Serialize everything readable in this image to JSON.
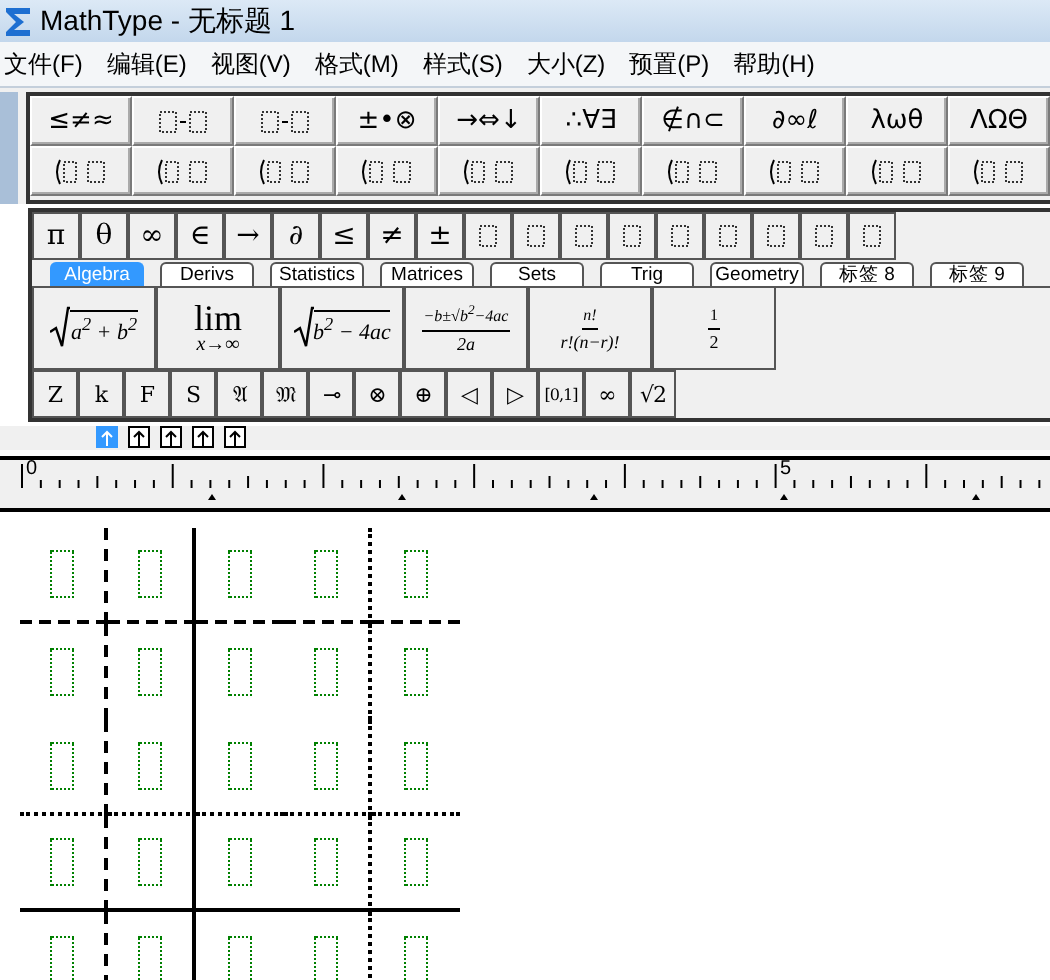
{
  "window": {
    "title": "MathType - 无标题 1"
  },
  "menu": [
    "文件(F)",
    "编辑(E)",
    "视图(V)",
    "格式(M)",
    "样式(S)",
    "大小(Z)",
    "预置(P)",
    "帮助(H)"
  ],
  "symbol_palettes": [
    {
      "kind": "text",
      "label": "≤≠≈"
    },
    {
      "kind": "template"
    },
    {
      "kind": "template"
    },
    {
      "kind": "text",
      "label": "±•⊗"
    },
    {
      "kind": "text",
      "label": "→⇔↓"
    },
    {
      "kind": "text",
      "label": "∴∀∃"
    },
    {
      "kind": "text",
      "label": "∉∩⊂"
    },
    {
      "kind": "text",
      "label": "∂∞ℓ"
    },
    {
      "kind": "text",
      "label": "λωθ"
    },
    {
      "kind": "text",
      "label": "ΛΩΘ"
    }
  ],
  "template_palettes": [
    {
      "kind": "template"
    },
    {
      "kind": "template"
    },
    {
      "kind": "template"
    },
    {
      "kind": "template"
    },
    {
      "kind": "template"
    },
    {
      "kind": "template"
    },
    {
      "kind": "template"
    },
    {
      "kind": "template"
    },
    {
      "kind": "template"
    },
    {
      "kind": "template"
    }
  ],
  "small_bar": [
    {
      "kind": "text",
      "label": "π"
    },
    {
      "kind": "text",
      "label": "θ"
    },
    {
      "kind": "text",
      "label": "∞"
    },
    {
      "kind": "text",
      "label": "∈"
    },
    {
      "kind": "text",
      "label": "→"
    },
    {
      "kind": "text",
      "label": "∂"
    },
    {
      "kind": "text",
      "label": "≤"
    },
    {
      "kind": "text",
      "label": "≠"
    },
    {
      "kind": "text",
      "label": "±"
    },
    {
      "kind": "template"
    },
    {
      "kind": "template"
    },
    {
      "kind": "template"
    },
    {
      "kind": "template"
    },
    {
      "kind": "template"
    },
    {
      "kind": "template"
    },
    {
      "kind": "template"
    },
    {
      "kind": "template"
    },
    {
      "kind": "template"
    }
  ],
  "tabs": [
    {
      "label": "Algebra",
      "selected": true
    },
    {
      "label": "Derivs",
      "selected": false
    },
    {
      "label": "Statistics",
      "selected": false
    },
    {
      "label": "Matrices",
      "selected": false
    },
    {
      "label": "Sets",
      "selected": false
    },
    {
      "label": "Trig",
      "selected": false
    },
    {
      "label": "Geometry",
      "selected": false
    },
    {
      "label": "标签 8",
      "selected": false
    },
    {
      "label": "标签 9",
      "selected": false
    }
  ],
  "expressions": [
    {
      "kind": "sqrt",
      "body": "a$^{2}$ + b$^{2}$"
    },
    {
      "kind": "limit",
      "top": "lim",
      "bottom": "x→∞"
    },
    {
      "kind": "sqrt",
      "body": "b$^{2}$ − 4ac"
    },
    {
      "kind": "fraction",
      "num": "−b±√b$^{2}$−4ac",
      "den": "2a"
    },
    {
      "kind": "fraction",
      "num": "n!",
      "den": "r!(n−r)!"
    },
    {
      "kind": "fraction",
      "num": "1",
      "den": "2"
    }
  ],
  "bottom_bar": [
    "Z",
    "k",
    "F",
    "S",
    "𝔄",
    "𝔐",
    "⊸",
    "⊗",
    "⊕",
    "◁",
    "▷",
    "[0,1]",
    "∞",
    "√2"
  ],
  "nudges": [
    {
      "selected": true
    },
    {
      "selected": false
    },
    {
      "selected": false
    },
    {
      "selected": false
    },
    {
      "selected": false
    }
  ],
  "ruler": {
    "labels": [
      "0",
      "5"
    ]
  },
  "matrix": {
    "column_lines": [
      {
        "kind": "dashed"
      },
      {
        "kind": "solid"
      },
      {
        "kind": "none"
      },
      {
        "kind": "dotted"
      }
    ],
    "row_lines": [
      {
        "kind": "dashed"
      },
      {
        "kind": "none"
      },
      {
        "kind": "dotted"
      },
      {
        "kind": "solid"
      }
    ]
  }
}
